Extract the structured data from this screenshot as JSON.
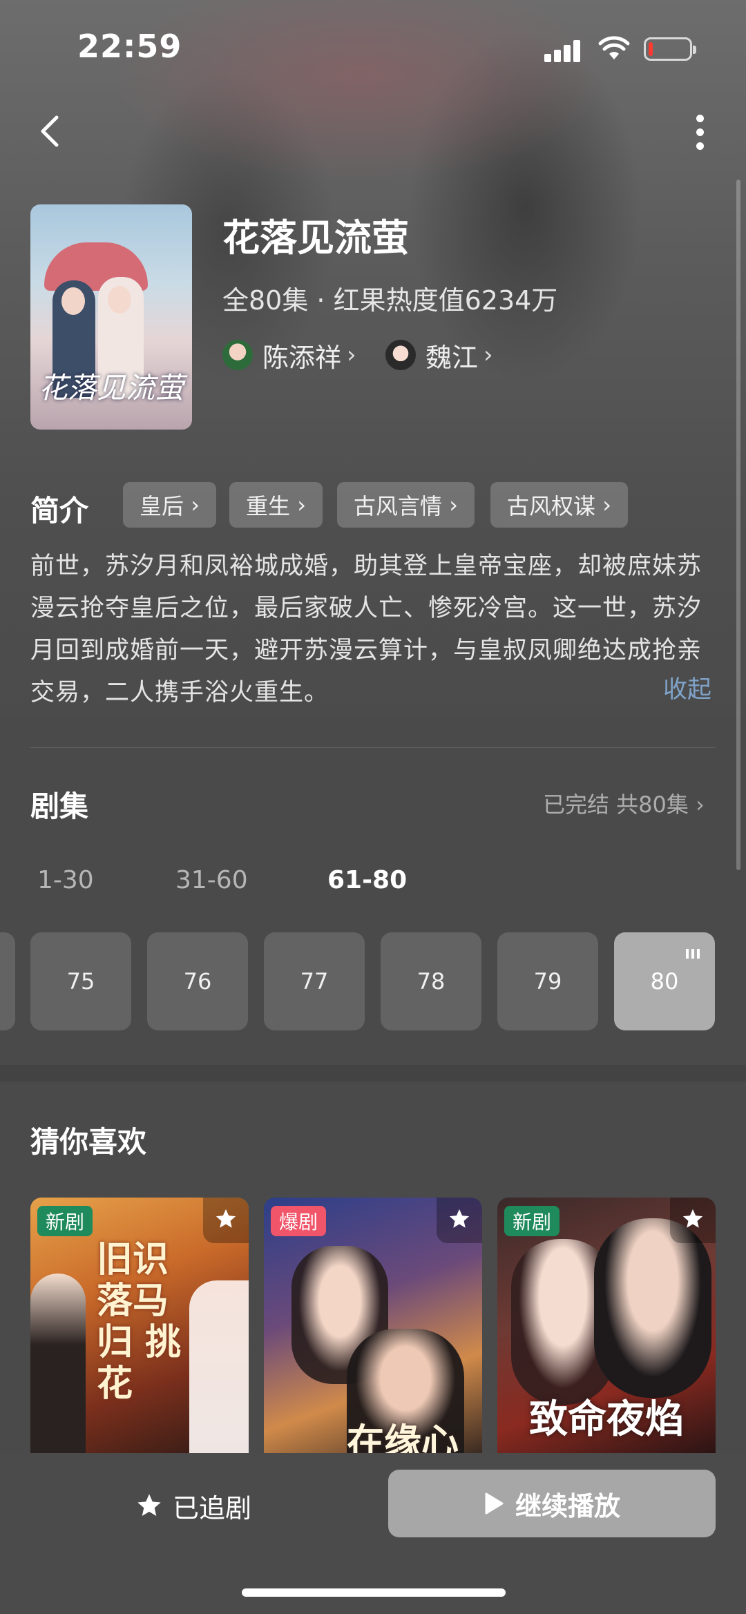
{
  "status_bar": {
    "time": "22:59"
  },
  "drama": {
    "title": "花落见流萤",
    "poster_title": "花落见流萤",
    "meta": "全80集 · 红果热度值6234万",
    "actors": [
      {
        "name": "陈添祥",
        "icon": "actor-avatar"
      },
      {
        "name": "魏江",
        "icon": "actor-avatar"
      }
    ]
  },
  "intro": {
    "label": "简介",
    "tags": [
      "皇后",
      "重生",
      "古风言情",
      "古风权谋"
    ],
    "synopsis": "前世，苏汐月和凤裕城成婚，助其登上皇帝宝座，却被庶妹苏漫云抢夺皇后之位，最后家破人亡、惨死冷宫。这一世，苏汐月回到成婚前一天，避开苏漫云算计，与皇叔凤卿绝达成抢亲交易，二人携手浴火重生。",
    "collapse_label": "收起"
  },
  "episodes": {
    "title": "剧集",
    "status": "已完结 共80集",
    "ranges": [
      "1-30",
      "31-60",
      "61-80"
    ],
    "active_range": "61-80",
    "items": [
      "75",
      "76",
      "77",
      "78",
      "79",
      "80"
    ],
    "current": "80"
  },
  "recommendations": {
    "title": "猜你喜欢",
    "cards": [
      {
        "badge": "新剧",
        "badge_color": "#1f8a5b",
        "poster_text": "旧识落马归 挑花"
      },
      {
        "badge": "爆剧",
        "badge_color": "#f0556a",
        "poster_text": "在缘心"
      },
      {
        "badge": "新剧",
        "badge_color": "#1f8a5b",
        "poster_text": "致命夜焰"
      }
    ]
  },
  "bottom_bar": {
    "follow_label": "已追剧",
    "play_label": "继续播放"
  },
  "colors": {
    "accent_link": "#7fa3c8",
    "badge_new": "#1f8a5b",
    "badge_hot": "#f0556a"
  }
}
